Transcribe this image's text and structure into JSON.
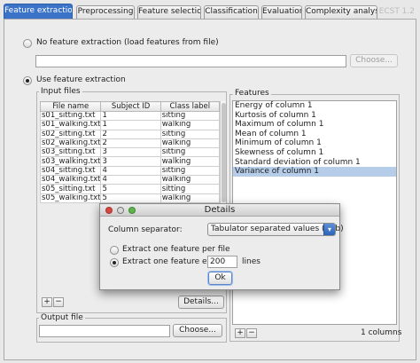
{
  "tabs": [
    {
      "label": "Feature extraction",
      "active": true
    },
    {
      "label": "Preprocessing"
    },
    {
      "label": "Feature selection"
    },
    {
      "label": "Classification"
    },
    {
      "label": "Evaluation"
    },
    {
      "label": "Complexity analysis"
    }
  ],
  "version": "ECST 1.2",
  "no_extraction": {
    "label": "No feature extraction (load features from file)",
    "selected": false,
    "path_value": "",
    "choose_label": "Choose..."
  },
  "use_extraction": {
    "label": "Use feature extraction",
    "selected": true
  },
  "input_files": {
    "title": "Input files",
    "columns": [
      "File name",
      "Subject ID",
      "Class label"
    ],
    "rows": [
      [
        "s01_sitting.txt",
        "1",
        "sitting"
      ],
      [
        "s01_walking.txt",
        "1",
        "walking"
      ],
      [
        "s02_sitting.txt",
        "2",
        "sitting"
      ],
      [
        "s02_walking.txt",
        "2",
        "walking"
      ],
      [
        "s03_sitting.txt",
        "3",
        "sitting"
      ],
      [
        "s03_walking.txt",
        "3",
        "walking"
      ],
      [
        "s04_sitting.txt",
        "4",
        "sitting"
      ],
      [
        "s04_walking.txt",
        "4",
        "walking"
      ],
      [
        "s05_sitting.txt",
        "5",
        "sitting"
      ],
      [
        "s05_walking.txt",
        "5",
        "walking"
      ]
    ],
    "add_label": "+",
    "remove_label": "−",
    "details_label": "Details..."
  },
  "output_file": {
    "title": "Output file",
    "value": "",
    "choose_label": "Choose..."
  },
  "features": {
    "title": "Features",
    "items": [
      "Energy of column 1",
      "Kurtosis of column 1",
      "Maximum of column 1",
      "Mean of column 1",
      "Minimum of column 1",
      "Skewness of column 1",
      "Standard deviation of column 1",
      "Variance of column 1"
    ],
    "selected_item": "Variance of column 1",
    "add_label": "+",
    "remove_label": "−",
    "columns_count": "1 columns"
  },
  "details_dialog": {
    "title": "Details",
    "separator_label": "Column separator:",
    "separator_value": "Tabulator separated values (.tab)",
    "option_per_file": "Extract one feature per file",
    "option_every": "Extract one feature every",
    "every_value": "200",
    "every_unit": "lines",
    "selected_option": "every",
    "ok_label": "Ok"
  },
  "colors": {
    "accent": "#3b73c8",
    "selection": "#b6cdea",
    "close_red": "#d6473f",
    "minimize_yellow": "#d8d8d8",
    "zoom_green": "#5fb44b"
  }
}
